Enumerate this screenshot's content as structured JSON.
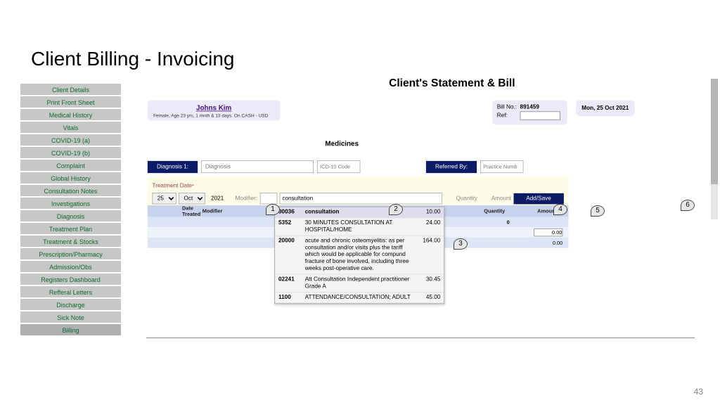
{
  "page_title": "Client Billing - Invoicing",
  "page_number": "43",
  "sidebar": {
    "items": [
      "Client Details",
      "Print Front Sheet",
      "Medical History",
      "Vitals",
      "COVID-19 (a)",
      "COVID-19 (b)",
      "Complaint",
      "Global History",
      "Consultation Notes",
      "Investigations",
      "Diagnosis",
      "Treatment Plan",
      "Treatment & Stocks",
      "Prescription/Pharmacy",
      "Admission/Obs",
      "Registers Dashboard",
      "Refferal Letters",
      "Discharge",
      "Sick Note",
      "Billing"
    ]
  },
  "statement_title": "Client's Statement & Bill",
  "patient": {
    "name": "Johns Kim",
    "details": "Female, Age 23 yrs, 1 mnth & 13 days. On CASH - USD"
  },
  "bill": {
    "no_label": "Bill No.:",
    "no_value": "891459",
    "ref_label": "Ref:",
    "ref_value": ""
  },
  "statement_date": "Mon, 25 Oct 2021",
  "medicines_label": "Medicines",
  "diagnosis": {
    "btn": "Diagnosis 1:",
    "placeholder": "Diagnosis",
    "icd_placeholder": "ICD-10 Code"
  },
  "referred": {
    "btn": "Referred By:",
    "placeholder": "Practice Numb"
  },
  "form": {
    "treatment_date_label": "Treatment Date",
    "day": "25",
    "month": "Oct",
    "year": "2021",
    "modifier_label": "Modifier:",
    "service_value": "consultation",
    "quantity_label": "Quantity",
    "amount_label": "Amount",
    "addsave": "Add/Save"
  },
  "grid": {
    "headers": {
      "dt": "Date Treated",
      "mod": "Modifier",
      "qty": "Quantity",
      "amt": "Amount"
    },
    "rows": [
      {
        "qty": "0",
        "amt": ""
      },
      {
        "qty": "",
        "amt": "0.00",
        "amt_input": true
      },
      {
        "qty": "",
        "amt": "0.00"
      }
    ]
  },
  "dropdown": {
    "items": [
      {
        "code": "90036",
        "desc": "consultation",
        "price": "10.00",
        "selected": true
      },
      {
        "code": "5352",
        "desc": "30 MINUTES CONSULTATION AT HOSPITAL/HOME",
        "price": "24.00"
      },
      {
        "code": "20000",
        "desc": "acute and chronic osteomyelitis: as per consultation and/or visits plus the tariff which would be applicable for compund fracture of bone involved, including three weeks post-operative care.",
        "price": "164.00"
      },
      {
        "code": "02241",
        "desc": "Att Consultation Independent practitioner Grade A",
        "price": "30.45"
      },
      {
        "code": "1100",
        "desc": "ATTENDANCE/CONSULTATION; ADULT",
        "price": "45.00"
      }
    ]
  },
  "callouts": {
    "c1": "1",
    "c2": "2",
    "c3": "3",
    "c4": "4",
    "c5": "5",
    "c6": "6"
  }
}
